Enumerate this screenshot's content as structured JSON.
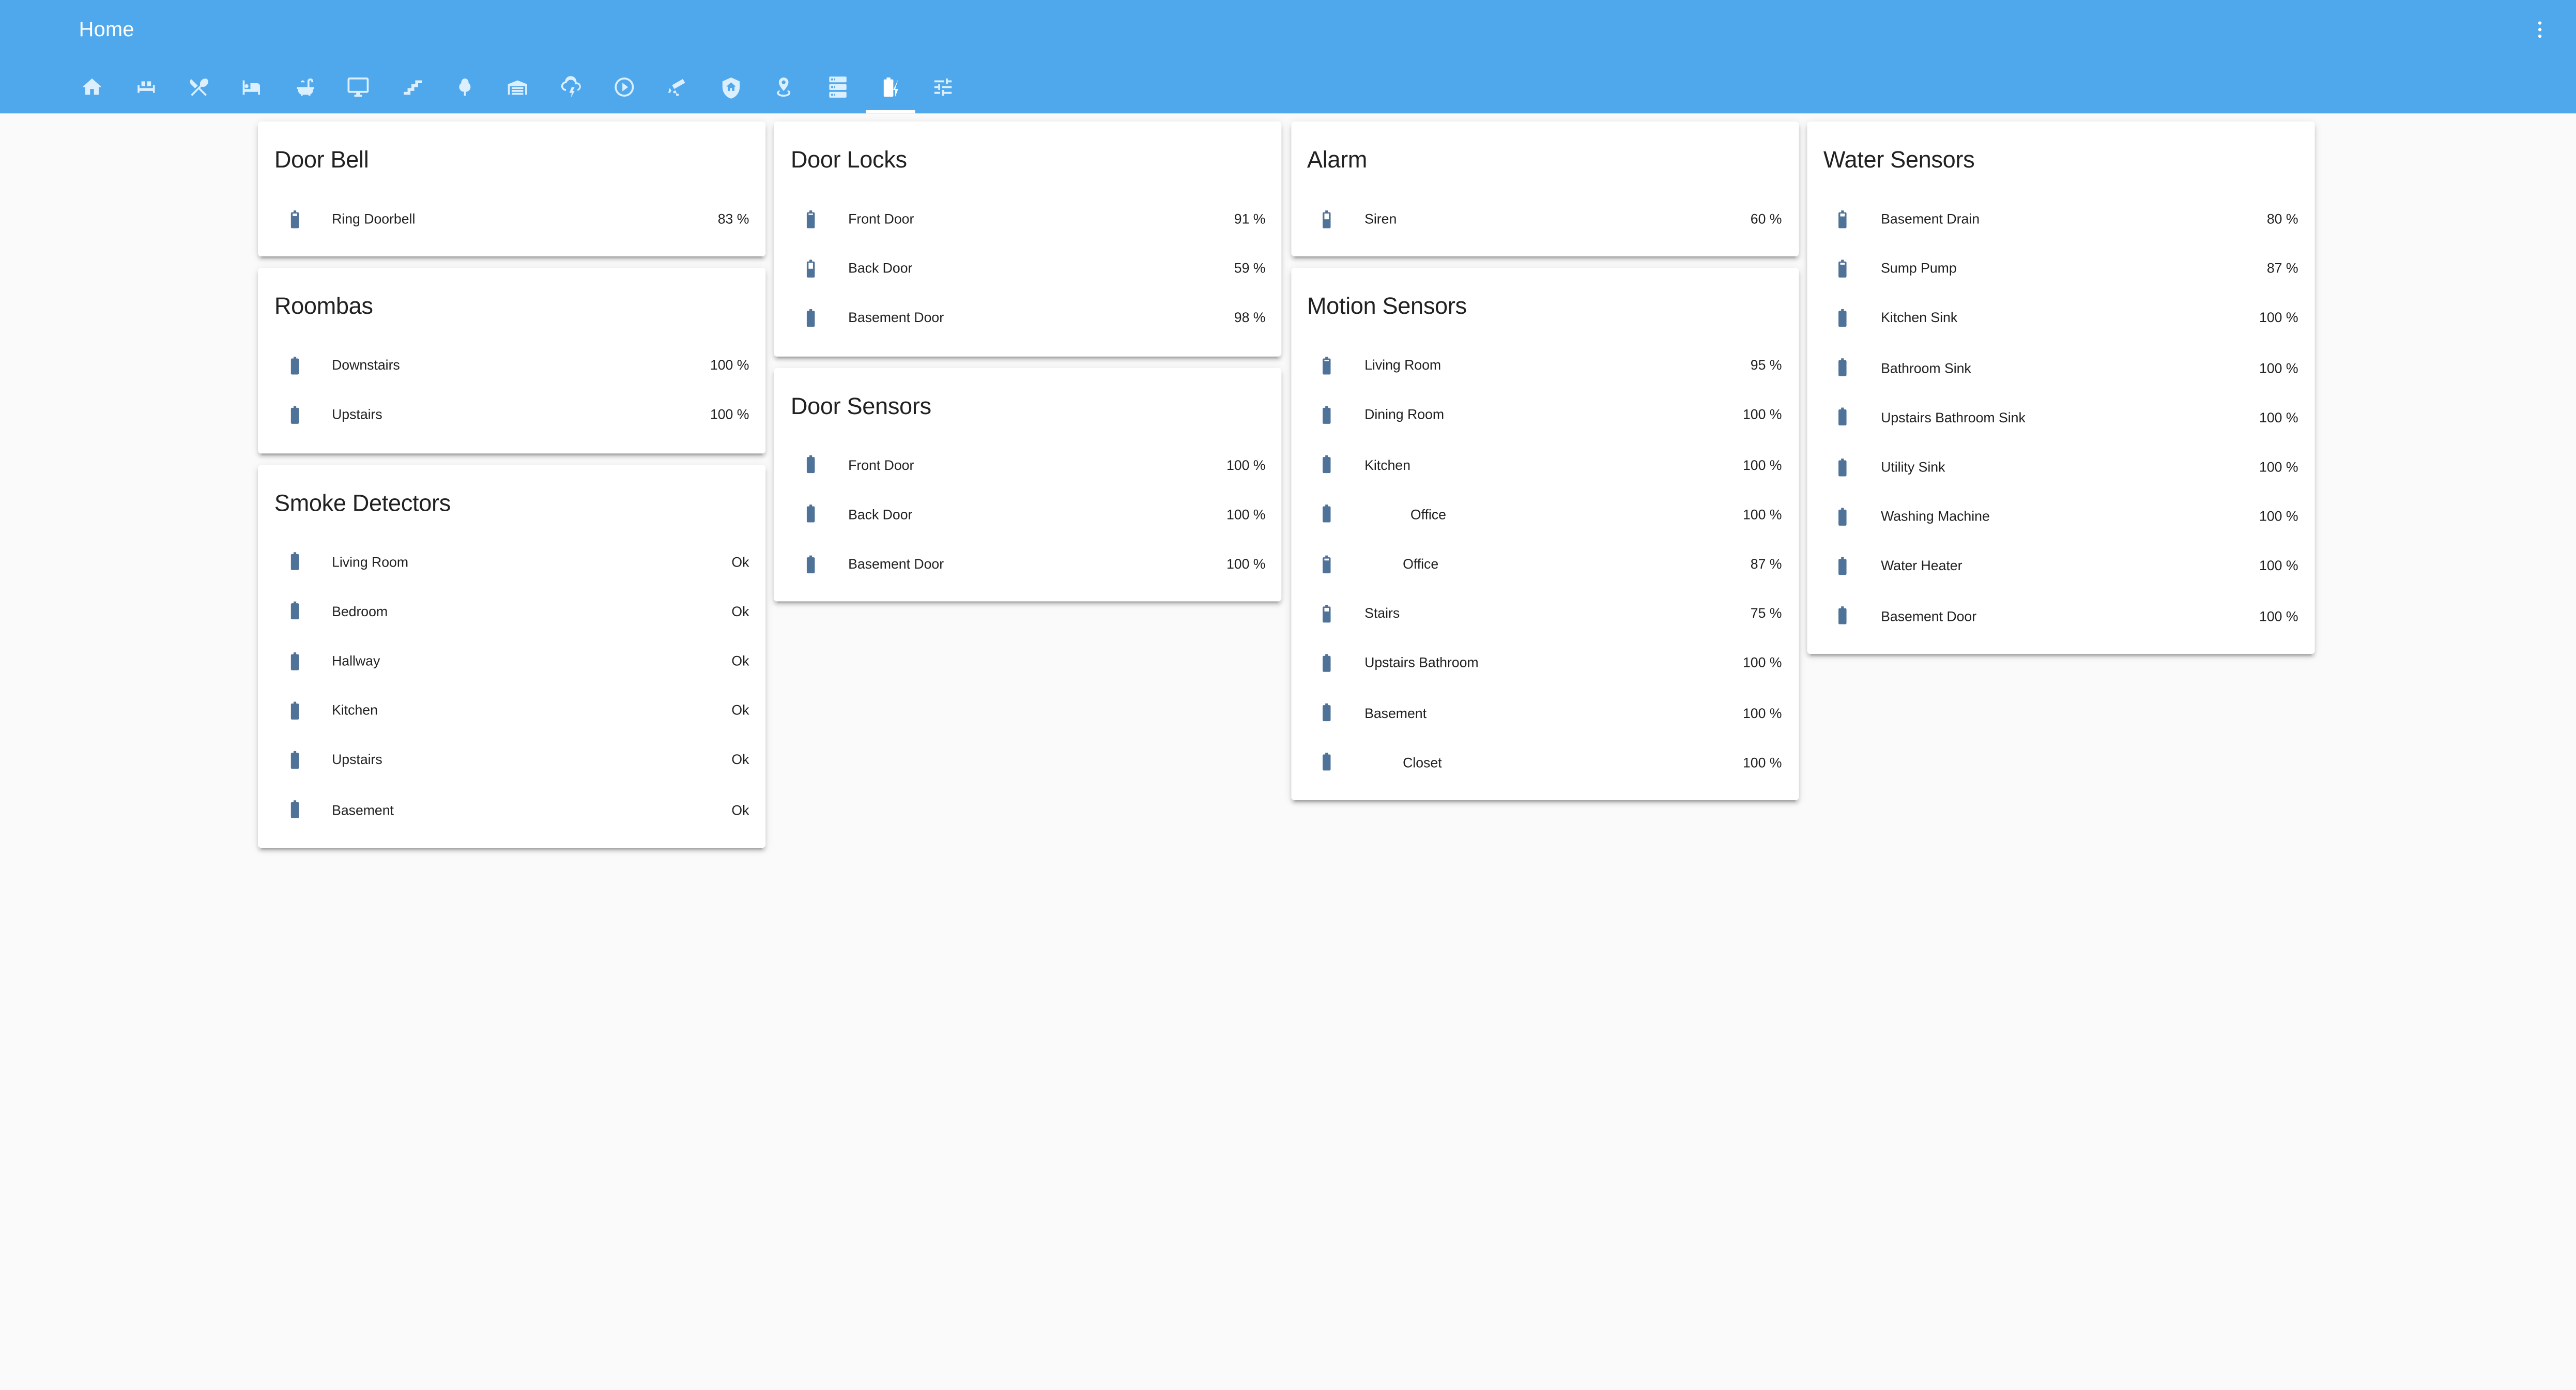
{
  "app": {
    "title": "Home",
    "menu_icon": "dots-vertical-icon",
    "header_color": "#4fa8ec",
    "icon_color": "#4f7298",
    "background_color": "#fafafa"
  },
  "tabs": [
    {
      "icon": "home-icon",
      "active": false
    },
    {
      "icon": "sofa-icon",
      "active": false
    },
    {
      "icon": "silverware-icon",
      "active": false
    },
    {
      "icon": "bed-icon",
      "active": false
    },
    {
      "icon": "bathtub-icon",
      "active": false
    },
    {
      "icon": "monitor-icon",
      "active": false
    },
    {
      "icon": "stairs-icon",
      "active": false
    },
    {
      "icon": "tree-icon",
      "active": false
    },
    {
      "icon": "garage-icon",
      "active": false
    },
    {
      "icon": "weather-lightning-icon",
      "active": false
    },
    {
      "icon": "play-circle-icon",
      "active": false
    },
    {
      "icon": "cctv-icon",
      "active": false
    },
    {
      "icon": "shield-home-icon",
      "active": false
    },
    {
      "icon": "map-marker-radius-icon",
      "active": false
    },
    {
      "icon": "server-icon",
      "active": false
    },
    {
      "icon": "battery-charging-icon",
      "active": true
    },
    {
      "icon": "tune-icon",
      "active": false
    }
  ],
  "columns": [
    [
      {
        "title": "Door Bell",
        "rows": [
          {
            "name": "Ring Doorbell",
            "state": "83 %",
            "level": 83
          }
        ]
      },
      {
        "title": "Roombas",
        "rows": [
          {
            "name": "Downstairs",
            "state": "100 %",
            "level": 100
          },
          {
            "name": "Upstairs",
            "state": "100 %",
            "level": 100
          }
        ]
      },
      {
        "title": "Smoke Detectors",
        "rows": [
          {
            "name": "Living Room",
            "state": "Ok",
            "level": 100
          },
          {
            "name": "Bedroom",
            "state": "Ok",
            "level": 100
          },
          {
            "name": "Hallway",
            "state": "Ok",
            "level": 100
          },
          {
            "name": "Kitchen",
            "state": "Ok",
            "level": 100
          },
          {
            "name": "Upstairs",
            "state": "Ok",
            "level": 100
          },
          {
            "name": "Basement",
            "state": "Ok",
            "level": 100
          }
        ]
      }
    ],
    [
      {
        "title": "Door Locks",
        "rows": [
          {
            "name": "Front Door",
            "state": "91 %",
            "level": 91
          },
          {
            "name": "Back Door",
            "state": "59 %",
            "level": 59
          },
          {
            "name": "Basement Door",
            "state": "98 %",
            "level": 98
          }
        ]
      },
      {
        "title": "Door Sensors",
        "rows": [
          {
            "name": "Front Door",
            "state": "100 %",
            "level": 100
          },
          {
            "name": "Back Door",
            "state": "100 %",
            "level": 100
          },
          {
            "name": "Basement Door",
            "state": "100 %",
            "level": 100
          }
        ]
      }
    ],
    [
      {
        "title": "Alarm",
        "rows": [
          {
            "name": "Siren",
            "state": "60 %",
            "level": 60
          }
        ]
      },
      {
        "title": "Motion Sensors",
        "rows": [
          {
            "name": "Living Room",
            "state": "95 %",
            "level": 95
          },
          {
            "name": "Dining Room",
            "state": "100 %",
            "level": 100
          },
          {
            "name": "Kitchen",
            "state": "100 %",
            "level": 100
          },
          {
            "name": "            Office",
            "state": "100 %",
            "level": 100
          },
          {
            "name": "          Office",
            "state": "87 %",
            "level": 87
          },
          {
            "name": "Stairs",
            "state": "75 %",
            "level": 75
          },
          {
            "name": "Upstairs Bathroom",
            "state": "100 %",
            "level": 100
          },
          {
            "name": "Basement",
            "state": "100 %",
            "level": 100
          },
          {
            "name": "          Closet",
            "state": "100 %",
            "level": 100
          }
        ]
      }
    ],
    [
      {
        "title": "Water Sensors",
        "rows": [
          {
            "name": "Basement Drain",
            "state": "80 %",
            "level": 80
          },
          {
            "name": "Sump Pump",
            "state": "87 %",
            "level": 87
          },
          {
            "name": "Kitchen Sink",
            "state": "100 %",
            "level": 100
          },
          {
            "name": "Bathroom Sink",
            "state": "100 %",
            "level": 100
          },
          {
            "name": "Upstairs Bathroom Sink",
            "state": "100 %",
            "level": 100
          },
          {
            "name": "Utility Sink",
            "state": "100 %",
            "level": 100
          },
          {
            "name": "Washing Machine",
            "state": "100 %",
            "level": 100
          },
          {
            "name": "Water Heater",
            "state": "100 %",
            "level": 100
          },
          {
            "name": "Basement Door",
            "state": "100 %",
            "level": 100
          }
        ]
      }
    ]
  ]
}
